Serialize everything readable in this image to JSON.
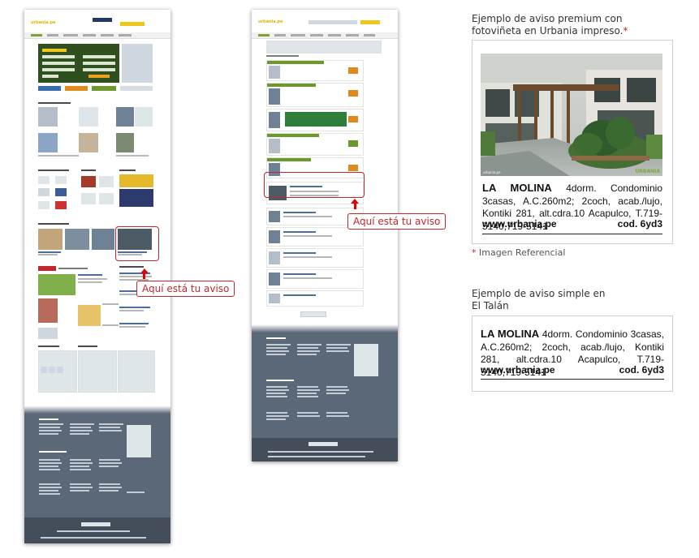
{
  "callouts": {
    "left": "Aquí está tu aviso",
    "middle": "Aquí está tu aviso"
  },
  "premium": {
    "caption_line1": "Ejemplo de aviso premium con",
    "caption_line2": "fotoviñeta en Urbania impreso.",
    "caption_star": "*",
    "photo_credit": "urbania.pe",
    "photo_stamp": "URBANIA",
    "ad_lead": "LA MOLINA",
    "ad_body": "4dorm. Condominio 3casas, A.C.260m2; 2coch, acab./lujo, Kontiki 281, alt.cdra.10 Acapulco, T.719-5140,719-5141",
    "ad_url": "www.urbania.pe",
    "ad_code": "cod. 6yd3",
    "footnote_star": "*",
    "footnote": "Imagen Referencial"
  },
  "simple": {
    "caption_line1": "Ejemplo de aviso simple en",
    "caption_line2": "El Talán",
    "ad_lead": "LA MOLINA",
    "ad_body": "4dorm. Condominio 3casas, A.C.260m2; 2coch, acab./lujo, Kontiki 281, alt.cdra.10 Acapulco, T.719-5140,719-5141",
    "ad_url": "www.urbania.pe",
    "ad_code": "cod. 6yd3"
  },
  "mockups": {
    "logo_main": "urbania",
    "logo_suffix": ".pe"
  },
  "colors": {
    "callout_red": "#c0272d",
    "arrow_red": "#e00000",
    "footer_slate": "#5b6878",
    "brand_green": "#6b9a2a"
  }
}
